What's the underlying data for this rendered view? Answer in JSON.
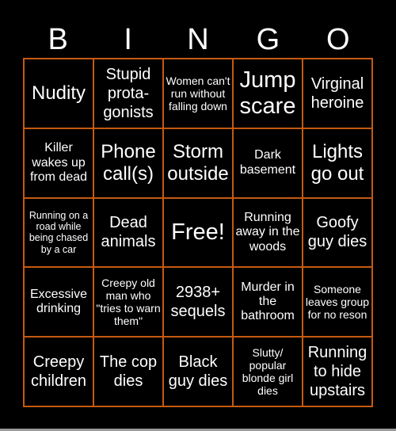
{
  "header": {
    "letters": [
      "B",
      "I",
      "N",
      "G",
      "O"
    ]
  },
  "theme": {
    "border_color": "#c55a11",
    "background": "#000000",
    "text_color": "#ffffff"
  },
  "cells": [
    [
      "Nudity",
      "Stupid prota-gonists",
      "Women can't run without falling down",
      "Jump scare",
      "Virginal heroine"
    ],
    [
      "Killer wakes up from dead",
      "Phone call(s)",
      "Storm outside",
      "Dark basement",
      "Lights go out"
    ],
    [
      "Running on a road while being chased by a car",
      "Dead animals",
      "Free!",
      "Running away in the woods",
      "Goofy guy dies"
    ],
    [
      "Excessive drinking",
      "Creepy old man who \"tries to warn them\"",
      "2938+ sequels",
      "Murder in the bathroom",
      "Someone leaves group for no reson"
    ],
    [
      "Creepy children",
      "The cop dies",
      "Black guy dies",
      "Slutty/ popular blonde girl dies",
      "Running to hide upstairs"
    ]
  ]
}
